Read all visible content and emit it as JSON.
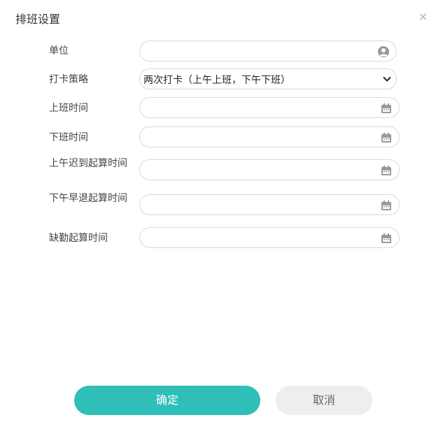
{
  "dialog": {
    "title": "排班设置",
    "close_glyph": "×"
  },
  "form": {
    "unit": {
      "label": "单位",
      "value": "",
      "icon": "user-circle-icon"
    },
    "policy": {
      "label": "打卡策略",
      "value": "两次打卡（上午上班，下午下班）",
      "icon": "chevron-down-icon"
    },
    "work_start": {
      "label": "上班时间",
      "value": "",
      "icon": "calendar-icon"
    },
    "work_end": {
      "label": "下班时间",
      "value": "",
      "icon": "calendar-icon"
    },
    "late_start": {
      "label": "上午迟到起算时间",
      "value": "",
      "icon": "calendar-icon"
    },
    "early_leave_start": {
      "label": "下午早退起算时间",
      "value": "",
      "icon": "calendar-icon"
    },
    "absence_start": {
      "label": "缺勤起算时间",
      "value": "",
      "icon": "calendar-icon"
    }
  },
  "buttons": {
    "confirm": "确定",
    "cancel": "取消"
  },
  "colors": {
    "accent": "#2fbfb8",
    "cancel_bg": "#eeeeee",
    "border": "#d9d9d9"
  }
}
